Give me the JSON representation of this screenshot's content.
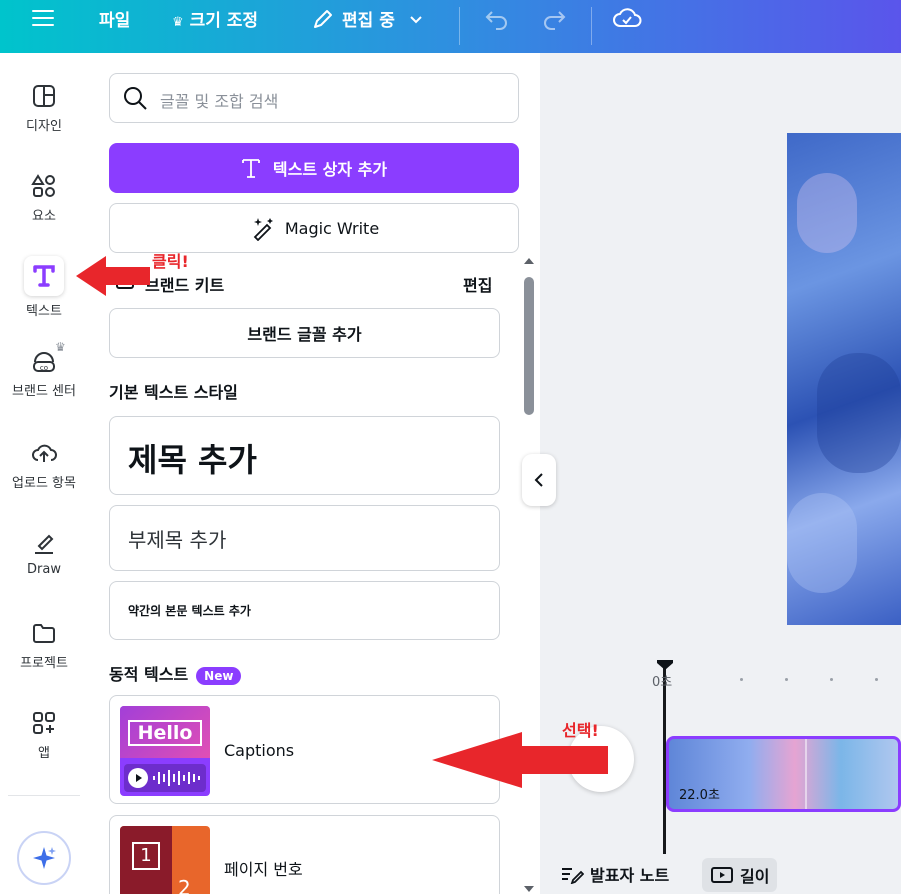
{
  "topbar": {
    "file": "파일",
    "resize": "크기 조정",
    "editing": "편집 중"
  },
  "rail": {
    "items": [
      {
        "label": "디자인"
      },
      {
        "label": "요소"
      },
      {
        "label": "텍스트"
      },
      {
        "label": "브랜드 센터"
      },
      {
        "label": "업로드 항목"
      },
      {
        "label": "Draw"
      },
      {
        "label": "프로젝트"
      },
      {
        "label": "앱"
      }
    ]
  },
  "panel": {
    "search_placeholder": "글꼴 및 조합 검색",
    "add_textbox": "텍스트 상자 추가",
    "magic_write": "Magic Write",
    "brand_kit": "브랜드 키트",
    "brand_edit": "편집",
    "add_brand_font": "브랜드 글꼴 추가",
    "basic_styles_heading": "기본 텍스트 스타일",
    "heading": "제목 추가",
    "subheading": "부제목 추가",
    "body": "약간의 본문 텍스트 추가",
    "dynamic_heading": "동적 텍스트",
    "new_badge": "New",
    "captions": "Captions",
    "captions_thumb": "Hello",
    "page_number": "페이지 번호",
    "page_number_thumb": "1",
    "page_number_thumb2": "2"
  },
  "timeline": {
    "time_marker": "0초",
    "clip_duration": "22.0초"
  },
  "bottombar": {
    "notes": "발표자 노트",
    "duration": "길이"
  },
  "annotations": {
    "click": "클릭!",
    "select": "선택!"
  },
  "colors": {
    "accent": "#8b3dff",
    "arrow": "#e8262b"
  }
}
